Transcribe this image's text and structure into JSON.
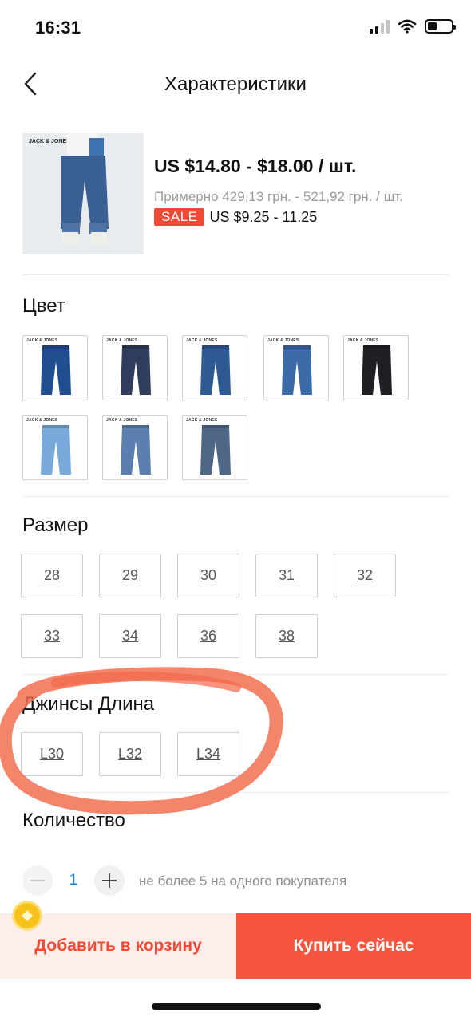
{
  "status_bar": {
    "time": "16:31"
  },
  "nav": {
    "title": "Характеристики",
    "back_icon": "chevron-left-icon"
  },
  "product": {
    "image_brand": "JACK & JONES",
    "price_usd": "US $14.80 - $18.00 / шт.",
    "price_uah": "Примерно 429,13 грн. - 521,92 грн. / шт.",
    "sale_badge": "SALE",
    "sale_price": "US $9.25 - 11.25"
  },
  "color_section": {
    "title": "Цвет",
    "swatches": [
      {
        "brand": "JACK & JONES",
        "color": "#1f4d8f"
      },
      {
        "brand": "JACK & JONES",
        "color": "#2f3c5c"
      },
      {
        "brand": "JACK & JONES",
        "color": "#2e5a94"
      },
      {
        "brand": "JACK & JONES",
        "color": "#3b6aa6"
      },
      {
        "brand": "JACK & JONES",
        "color": "#1e1f24"
      },
      {
        "brand": "JACK & JONES",
        "color": "#79a9d8"
      },
      {
        "brand": "JACK & JONES",
        "color": "#5b7fae"
      },
      {
        "brand": "JACK & JONES",
        "color": "#4f6787"
      }
    ]
  },
  "size_section": {
    "title": "Размер",
    "sizes": [
      "28",
      "29",
      "30",
      "31",
      "32",
      "33",
      "34",
      "36",
      "38"
    ]
  },
  "length_section": {
    "title": "Джинсы Длина",
    "lengths": [
      "L30",
      "L32",
      "L34"
    ]
  },
  "quantity_section": {
    "title": "Количество",
    "value": "1",
    "note": "не более 5 на одного покупателя"
  },
  "actions": {
    "add_to_cart": "Добавить в корзину",
    "buy_now": "Купить сейчас"
  },
  "colors": {
    "accent": "#f5553e",
    "sale_badge": "#f04a37",
    "highlight_stroke": "#f26a4b",
    "qty_value": "#1a7bd6"
  }
}
